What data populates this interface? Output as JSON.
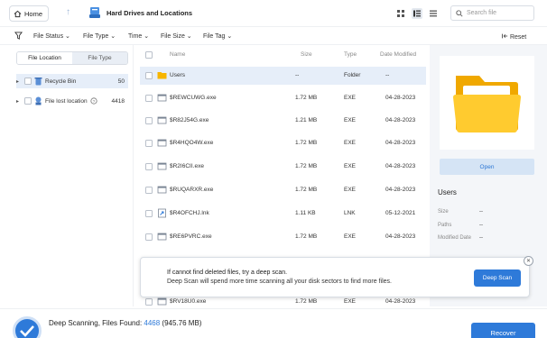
{
  "topbar": {
    "home_label": "Home",
    "location_title": "Hard Drives and Locations",
    "search_placeholder": "Search file"
  },
  "filters": {
    "file_status": "File Status",
    "file_type": "File Type",
    "time": "Time",
    "file_size": "File Size",
    "file_tag": "File Tag",
    "reset": "Reset"
  },
  "sidebar": {
    "tabs": [
      {
        "label": "File Location"
      },
      {
        "label": "File Type"
      }
    ],
    "items": [
      {
        "label": "Recycle Bin",
        "count": "50"
      },
      {
        "label": "File lost location",
        "count": "4418"
      }
    ]
  },
  "table": {
    "headers": {
      "name": "Name",
      "size": "Size",
      "type": "Type",
      "date": "Date Modified"
    },
    "rows": [
      {
        "name": "Users",
        "size": "--",
        "type": "Folder",
        "date": "--"
      },
      {
        "name": "$REWCUWG.exe",
        "size": "1.72 MB",
        "type": "EXE",
        "date": "04-28-2023"
      },
      {
        "name": "$R82J54G.exe",
        "size": "1.21 MB",
        "type": "EXE",
        "date": "04-28-2023"
      },
      {
        "name": "$R4HQO4W.exe",
        "size": "1.72 MB",
        "type": "EXE",
        "date": "04-28-2023"
      },
      {
        "name": "$R2I6CII.exe",
        "size": "1.72 MB",
        "type": "EXE",
        "date": "04-28-2023"
      },
      {
        "name": "$RUQARXR.exe",
        "size": "1.72 MB",
        "type": "EXE",
        "date": "04-28-2023"
      },
      {
        "name": "$R4OFCHJ.lnk",
        "size": "1.11 KB",
        "type": "LNK",
        "date": "05-12-2021"
      },
      {
        "name": "$RE6PVRC.exe",
        "size": "1.72 MB",
        "type": "EXE",
        "date": "04-28-2023"
      },
      {
        "name": "$RV18U0.exe",
        "size": "1.72 MB",
        "type": "EXE",
        "date": "04-28-2023"
      }
    ]
  },
  "details": {
    "open_label": "Open",
    "title": "Users",
    "size_label": "Size",
    "size_value": "--",
    "path_label": "Paths",
    "path_value": "--",
    "modified_label": "Modified Date",
    "modified_value": "--"
  },
  "popup": {
    "line1": "If cannot find deleted files, try a deep scan.",
    "line2": "Deep Scan will spend more time scanning all your disk sectors to find more files.",
    "button": "Deep Scan"
  },
  "status": {
    "prefix": "Deep Scanning, Files Found: ",
    "count": "4468",
    "size": " (945.76 MB)",
    "recover_label": "Recover"
  },
  "colors": {
    "accent": "#2e7ad9",
    "selected_row": "#e6eef9",
    "folder": "#f7b500"
  }
}
